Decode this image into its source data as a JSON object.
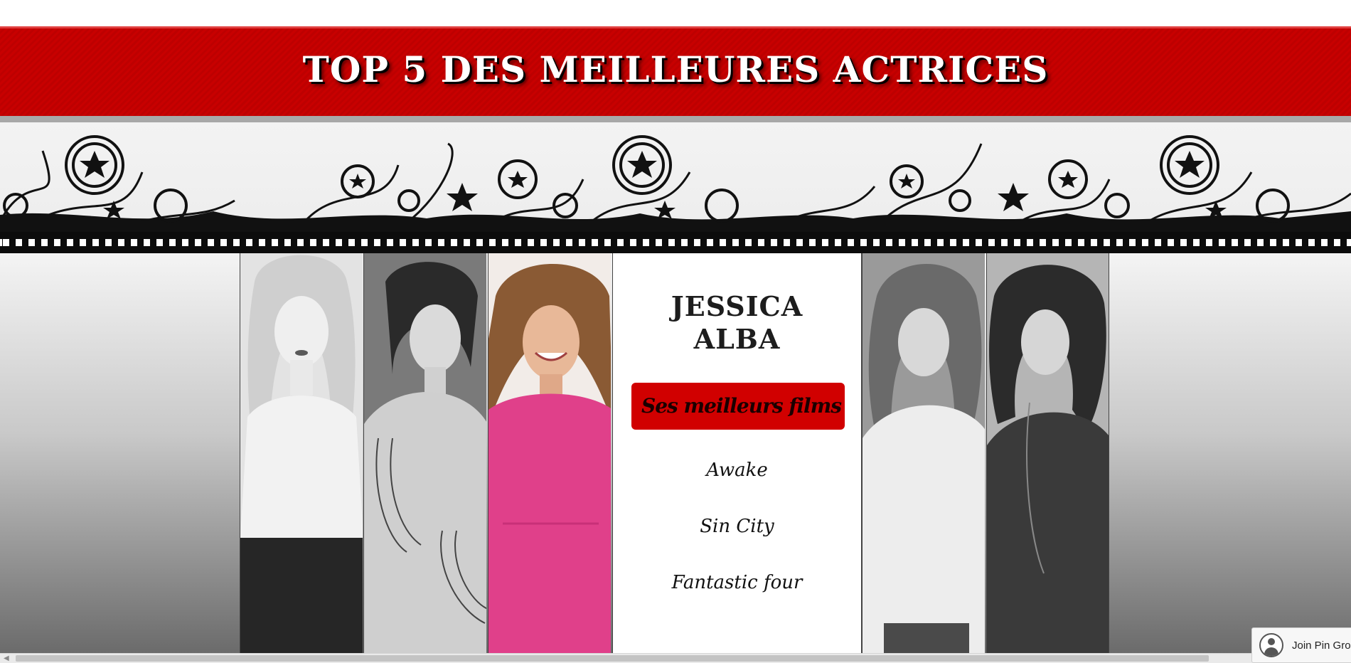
{
  "header": {
    "title": "TOP 5 DES MEILLEURES ACTRICES"
  },
  "actress": {
    "first_name": "JESSICA",
    "last_name": "ALBA",
    "films_button": "Ses meilleurs films",
    "films": [
      "Awake",
      "Sin City",
      "Fantastic four"
    ]
  },
  "widget": {
    "label": "Join Pin Grou"
  },
  "colors": {
    "header_red": "#c80000",
    "button_red": "#d10000",
    "pink_dress": "#e0408a"
  }
}
